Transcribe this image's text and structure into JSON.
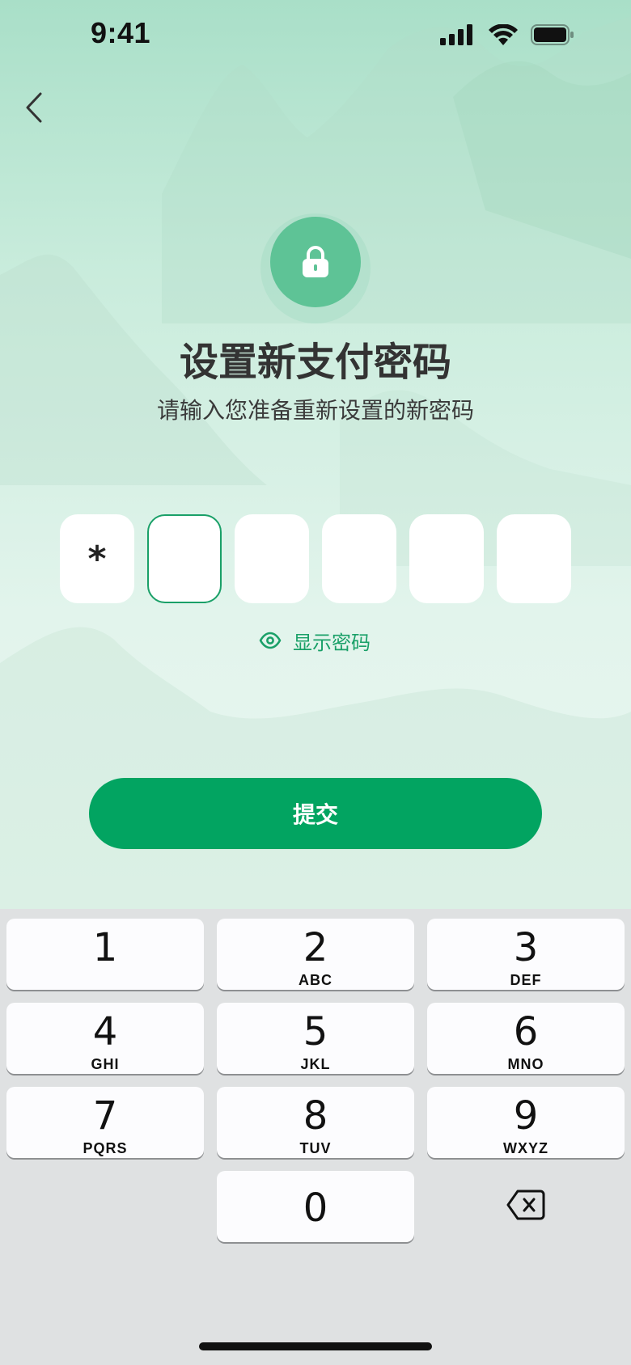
{
  "status_bar": {
    "time": "9:41"
  },
  "icons": {
    "back": "chevron-left-icon",
    "lock": "lock-icon",
    "eye": "eye-icon",
    "delete": "backspace-icon"
  },
  "header": {
    "title": "设置新支付密码",
    "subtitle": "请输入您准备重新设置的新密码"
  },
  "pin": {
    "digits": [
      "*",
      "",
      "",
      "",
      "",
      ""
    ],
    "length": 6,
    "filled": 1
  },
  "show_password_label": "显示密码",
  "submit_label": "提交",
  "keypad": {
    "k1": {
      "num": "1",
      "letters": ""
    },
    "k2": {
      "num": "2",
      "letters": "ABC"
    },
    "k3": {
      "num": "3",
      "letters": "DEF"
    },
    "k4": {
      "num": "4",
      "letters": "GHI"
    },
    "k5": {
      "num": "5",
      "letters": "JKL"
    },
    "k6": {
      "num": "6",
      "letters": "MNO"
    },
    "k7": {
      "num": "7",
      "letters": "PQRS"
    },
    "k8": {
      "num": "8",
      "letters": "TUV"
    },
    "k9": {
      "num": "9",
      "letters": "WXYZ"
    },
    "k0": {
      "num": "0",
      "letters": ""
    }
  },
  "colors": {
    "accent": "#02a461",
    "lock_circle": "#5ec396",
    "keypad_bg": "#dfe1e2"
  }
}
